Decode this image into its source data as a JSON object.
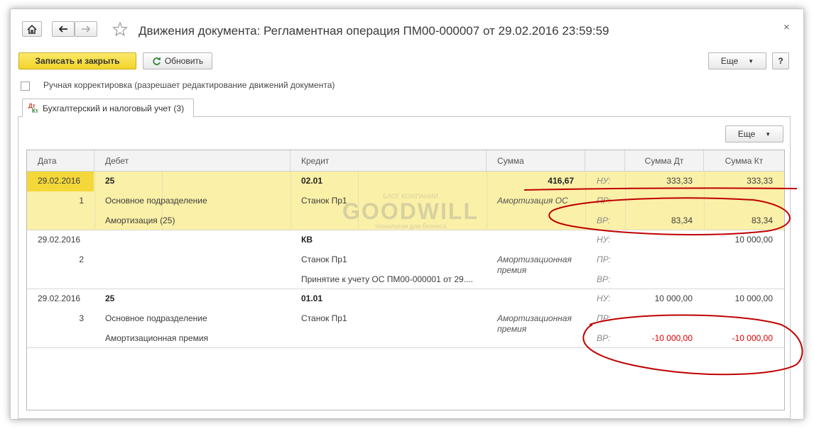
{
  "header": {
    "title": "Движения документа: Регламентная операция ПМ00-000007 от 29.02.2016 23:59:59",
    "close_glyph": "×"
  },
  "toolbar": {
    "save_close_label": "Записать и закрыть",
    "refresh_label": "Обновить",
    "more_label": "Еще",
    "help_label": "?"
  },
  "manual_edit": {
    "label": "Ручная корректировка (разрешает редактирование движений документа)",
    "checked": false
  },
  "tabs": [
    {
      "label": "Бухгалтерский и налоговый учет (3)",
      "icon": "dt-kt-icon",
      "icon_text_top": "Дт",
      "icon_text_bottom": "Кт"
    }
  ],
  "grid_toolbar": {
    "more_label": "Еще"
  },
  "table": {
    "columns": [
      "Дата",
      "Дебет",
      "Кредит",
      "Сумма",
      "",
      "Сумма Дт",
      "Сумма Кт"
    ],
    "records": [
      {
        "date": "29.02.2016",
        "num": "1",
        "debet": [
          "25",
          "Основное подразделение",
          "Амортизация (25)"
        ],
        "credit": [
          "02.01",
          "Станок Пр1",
          ""
        ],
        "sum": "416,67",
        "content": "Амортизация ОС",
        "labels": [
          "НУ:",
          "ПР:",
          "ВР:"
        ],
        "sum_dt": [
          "333,33",
          "",
          "83,34"
        ],
        "sum_kt": [
          "333,33",
          "",
          "83,34"
        ]
      },
      {
        "date": "29.02.2016",
        "num": "2",
        "debet": [
          "",
          "",
          ""
        ],
        "credit": [
          "КВ",
          "Станок Пр1",
          "Принятие к учету ОС ПМ00-000001 от 29...."
        ],
        "sum": "",
        "content": "Амортизационная премия",
        "labels": [
          "НУ:",
          "ПР:",
          "ВР:"
        ],
        "sum_dt": [
          "",
          "",
          ""
        ],
        "sum_kt": [
          "10 000,00",
          "",
          ""
        ]
      },
      {
        "date": "29.02.2016",
        "num": "3",
        "debet": [
          "25",
          "Основное подразделение",
          "Амортизационная премия"
        ],
        "credit": [
          "01.01",
          "Станок Пр1",
          ""
        ],
        "sum": "",
        "content": "Амортизационная премия",
        "labels": [
          "НУ:",
          "ПР:",
          "ВР:"
        ],
        "sum_dt": [
          "10 000,00",
          "",
          "-10 000,00"
        ],
        "sum_kt": [
          "10 000,00",
          "",
          "-10 000,00"
        ]
      }
    ]
  },
  "watermark": {
    "top": "БЛОГ КОМПАНИИ",
    "main": "GOODWILL",
    "bottom": "технологии для бизнеса"
  },
  "colors": {
    "accent_yellow": "#f2d42a",
    "selected_row": "#fbf0a7",
    "negative": "#e00000",
    "annotation": "#c00000"
  }
}
